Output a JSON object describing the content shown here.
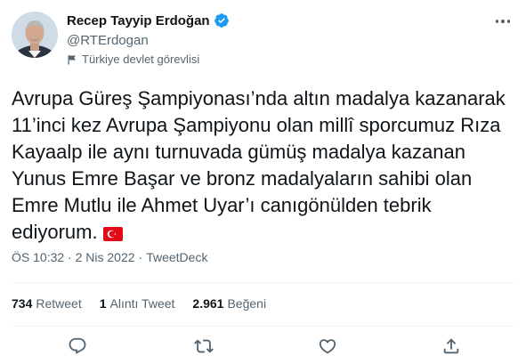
{
  "user": {
    "display_name": "Recep Tayyip Erdoğan",
    "handle": "@RTErdogan",
    "account_label": "Türkiye devlet görevlisi"
  },
  "tweet": {
    "text": "Avrupa Güreş Şampiyonası’nda altın madalya kazanarak 11’inci kez Avrupa Şampiyonu olan millî sporcumuz Rıza Kayaalp ile aynı turnuvada gümüş madalya kazanan Yunus Emre Başar ve bronz madalyaların sahibi olan Emre Mutlu ile Ahmet Uyar’ı canıgönülden tebrik ediyorum.",
    "timestamp": "ÖS 10:32 · 2 Nis 2022",
    "separator": "·",
    "source": "TweetDeck"
  },
  "stats": {
    "retweets_count": "734",
    "retweets_label": "Retweet",
    "quotes_count": "1",
    "quotes_label": "Alıntı Tweet",
    "likes_count": "2.961",
    "likes_label": "Beğeni"
  },
  "icons": {
    "verified": "verified-badge-icon",
    "more": "more-options-icon",
    "label": "flag-icon",
    "reply": "reply-icon",
    "retweet": "retweet-icon",
    "like": "like-icon",
    "share": "share-icon",
    "emoji": "turkey-flag-emoji"
  },
  "colors": {
    "verified": "#1d9bf0",
    "text": "#0f1419",
    "secondary": "#536471",
    "flag_red": "#e30a17"
  }
}
